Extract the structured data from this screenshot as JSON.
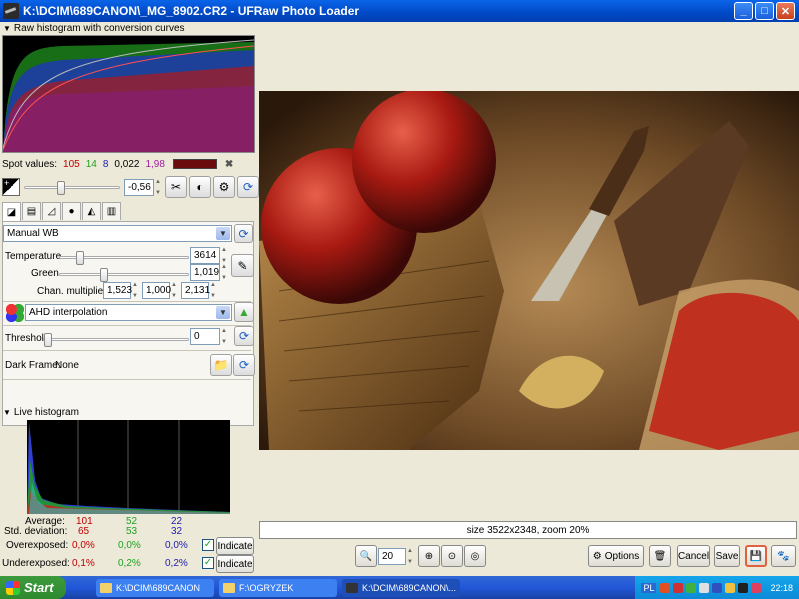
{
  "window": {
    "title": "K:\\DCIM\\689CANON\\_MG_8902.CR2 - UFRaw Photo Loader",
    "min": "_",
    "max": "□",
    "close": "✕"
  },
  "raw_histogram": {
    "label": "Raw histogram with conversion curves"
  },
  "spot": {
    "label": "Spot values:",
    "r": "105",
    "g": "14",
    "b": "8",
    "lum": "0,022",
    "adj": "1,98",
    "r_color": "#c00000",
    "g_color": "#21a121",
    "b_color": "#2020b0",
    "adj_color": "#a020a0",
    "swatch_color": "#6b0c0c"
  },
  "exposure": {
    "value": "-0,56"
  },
  "wb": {
    "mode": "Manual WB",
    "temp_label": "Temperature",
    "temp_value": "3614",
    "green_label": "Green",
    "green_value": "1,019",
    "mult_label": "Chan. multipliers:",
    "mult": [
      "1,523",
      "1,000",
      "2,131"
    ]
  },
  "interp": {
    "mode": "AHD interpolation"
  },
  "threshold": {
    "label": "Threshold",
    "value": "0"
  },
  "darkframe": {
    "label": "Dark Frame:",
    "value": "None"
  },
  "live_histogram": {
    "label": "Live histogram"
  },
  "stats": {
    "avg_label": "Average:",
    "avg": [
      "101",
      "52",
      "22"
    ],
    "std_label": "Std. deviation:",
    "std": [
      "65",
      "53",
      "32"
    ],
    "over_label": "Overexposed:",
    "over": [
      "0,0%",
      "0,0%",
      "0,0%"
    ],
    "under_label": "Underexposed:",
    "under": [
      "0,1%",
      "0,2%",
      "0,2%"
    ],
    "indicate": "Indicate"
  },
  "status": {
    "text": "size 3522x2348, zoom 20%"
  },
  "zoom": {
    "value": "20"
  },
  "buttons": {
    "options": "Options",
    "cancel": "Cancel",
    "save": "Save"
  },
  "taskbar": {
    "start": "Start",
    "items": [
      "K:\\DCIM\\689CANON",
      "F:\\OGRYZEK",
      "K:\\DCIM\\689CANON\\..."
    ],
    "lang": "PL",
    "clock": "22:18"
  }
}
